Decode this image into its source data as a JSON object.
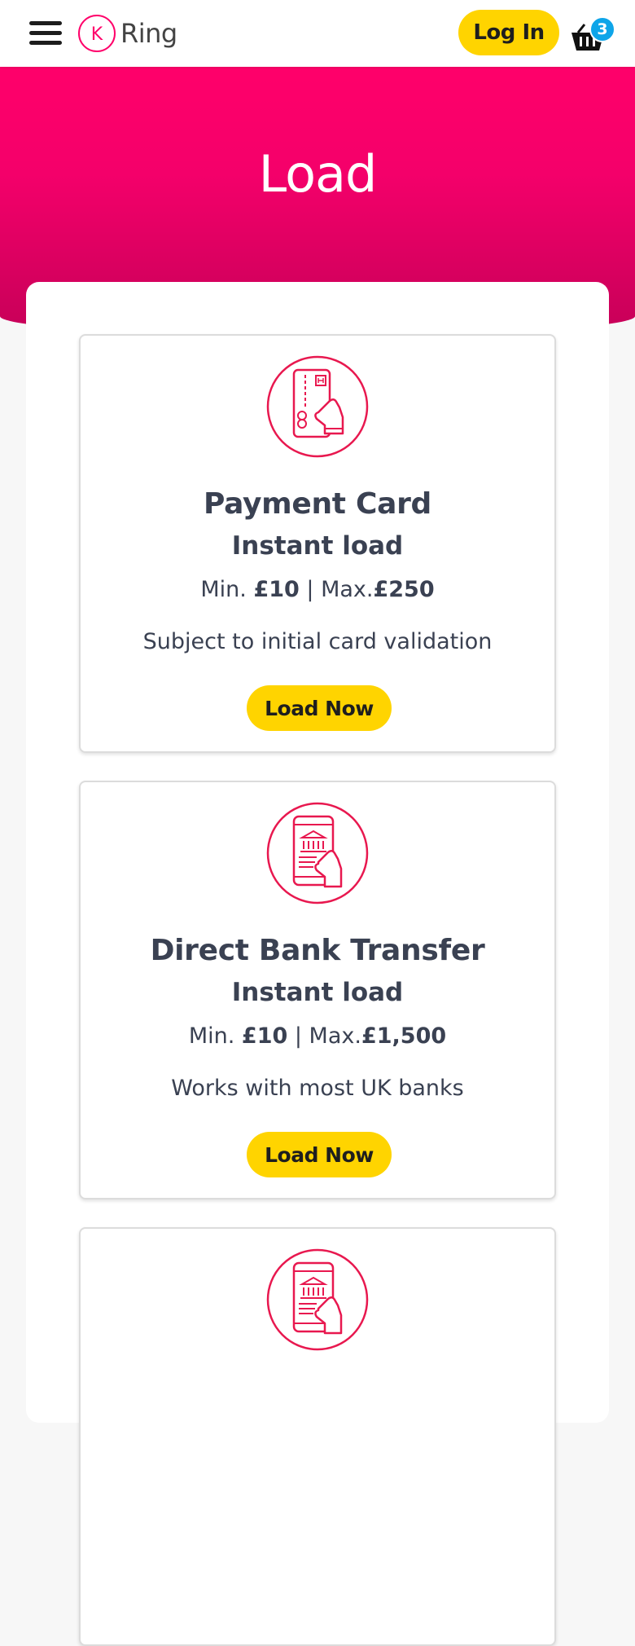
{
  "header": {
    "logo_text": "Ring",
    "logo_letter": "K",
    "login_label": "Log In",
    "basket_count": "3"
  },
  "hero": {
    "title": "Load"
  },
  "cards": [
    {
      "icon": "card-in-hand-icon",
      "title": "Payment Card",
      "subtitle": "Instant load",
      "min_label": "Min. ",
      "min_value": "£10",
      "separator": " | ",
      "max_label": "Max.",
      "max_value": "£250",
      "note": "Subject to initial card validation",
      "button": "Load Now"
    },
    {
      "icon": "bank-phone-icon",
      "title": "Direct Bank Transfer",
      "subtitle": "Instant load",
      "min_label": "Min. ",
      "min_value": "£10",
      "separator": " | ",
      "max_label": "Max.",
      "max_value": "£1,500",
      "note": "Works with most UK banks",
      "button": "Load Now"
    },
    {
      "icon": "bank-phone-icon"
    }
  ],
  "colors": {
    "brand_pink": "#ff006a",
    "button_yellow": "#ffd400",
    "badge_blue": "#0ea5e9",
    "text_dark": "#3a4152"
  }
}
